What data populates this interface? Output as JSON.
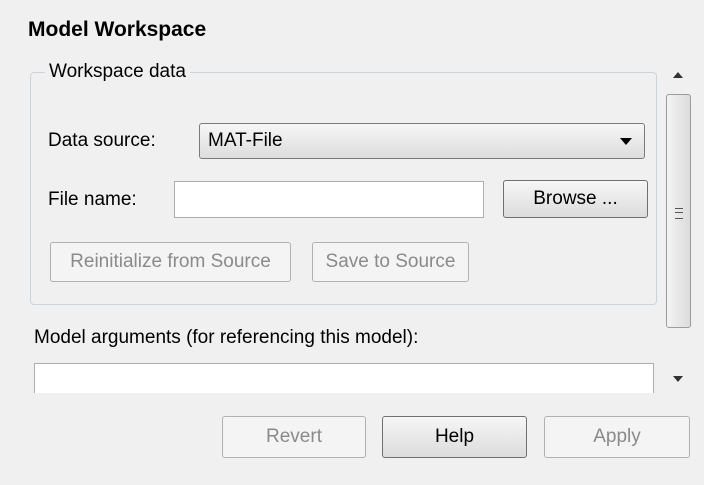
{
  "page": {
    "title": "Model Workspace"
  },
  "workspace_data": {
    "group_label": "Workspace data",
    "data_source_label": "Data source:",
    "data_source_value": "MAT-File",
    "file_name_label": "File name:",
    "file_name_value": "",
    "browse_label": "Browse ...",
    "reinitialize_label": "Reinitialize from Source",
    "save_label": "Save to Source"
  },
  "model_arguments": {
    "label": "Model arguments (for referencing this model):",
    "value": ""
  },
  "footer": {
    "revert_label": "Revert",
    "help_label": "Help",
    "apply_label": "Apply"
  },
  "icons": {
    "combo_arrow": "chevron-down-icon",
    "scroll_up": "scroll-up-arrow-icon",
    "scroll_down": "scroll-down-arrow-icon",
    "thumb_grip": "grip-icon"
  }
}
